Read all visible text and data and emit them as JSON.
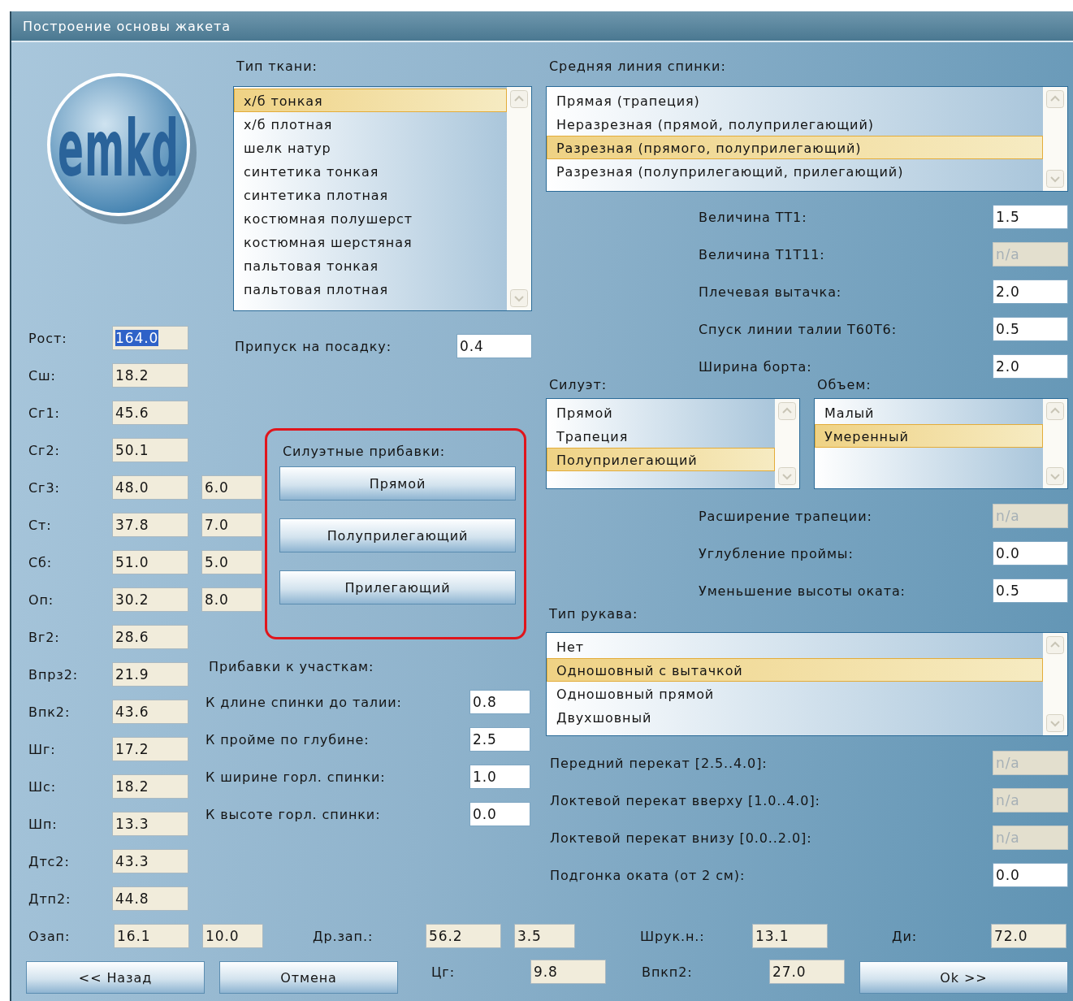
{
  "window": {
    "title": "Построение основы жакета"
  },
  "logo": {
    "text": "emkd"
  },
  "measurements": [
    {
      "label": "Рост:",
      "fields": [
        {
          "value": "164.0",
          "kind": "calc",
          "highlighted": true
        }
      ]
    },
    {
      "label": "Сш:",
      "fields": [
        {
          "value": "18.2",
          "kind": "calc"
        }
      ]
    },
    {
      "label": "Сг1:",
      "fields": [
        {
          "value": "45.6",
          "kind": "calc"
        }
      ]
    },
    {
      "label": "Сг2:",
      "fields": [
        {
          "value": "50.1",
          "kind": "calc"
        }
      ]
    },
    {
      "label": "Сг3:",
      "fields": [
        {
          "value": "48.0",
          "kind": "calc"
        },
        {
          "value": "6.0",
          "kind": "calc"
        }
      ]
    },
    {
      "label": "Ст:",
      "fields": [
        {
          "value": "37.8",
          "kind": "calc"
        },
        {
          "value": "7.0",
          "kind": "calc"
        }
      ]
    },
    {
      "label": "Сб:",
      "fields": [
        {
          "value": "51.0",
          "kind": "calc"
        },
        {
          "value": "5.0",
          "kind": "calc"
        }
      ]
    },
    {
      "label": "Оп:",
      "fields": [
        {
          "value": "30.2",
          "kind": "calc"
        },
        {
          "value": "8.0",
          "kind": "calc"
        }
      ]
    },
    {
      "label": "Вг2:",
      "fields": [
        {
          "value": "28.6",
          "kind": "calc"
        }
      ]
    },
    {
      "label": "Впрз2:",
      "fields": [
        {
          "value": "21.9",
          "kind": "calc"
        }
      ]
    },
    {
      "label": "Впк2:",
      "fields": [
        {
          "value": "43.6",
          "kind": "calc"
        }
      ]
    },
    {
      "label": "Шг:",
      "fields": [
        {
          "value": "17.2",
          "kind": "calc"
        }
      ]
    },
    {
      "label": "Шс:",
      "fields": [
        {
          "value": "18.2",
          "kind": "calc"
        }
      ]
    },
    {
      "label": "Шп:",
      "fields": [
        {
          "value": "13.3",
          "kind": "calc"
        }
      ]
    },
    {
      "label": "Дтс2:",
      "fields": [
        {
          "value": "43.3",
          "kind": "calc"
        }
      ]
    },
    {
      "label": "Дтп2:",
      "fields": [
        {
          "value": "44.8",
          "kind": "calc"
        }
      ]
    }
  ],
  "fabric": {
    "label": "Тип ткани:",
    "items": [
      {
        "label": "х/б тонкая",
        "selected": true
      },
      {
        "label": "х/б плотная",
        "selected": false
      },
      {
        "label": "шелк натур",
        "selected": false
      },
      {
        "label": "синтетика тонкая",
        "selected": false
      },
      {
        "label": "синтетика плотная",
        "selected": false
      },
      {
        "label": "костюмная полушерст",
        "selected": false
      },
      {
        "label": "костюмная шерстяная",
        "selected": false
      },
      {
        "label": "пальтовая тонкая",
        "selected": false
      },
      {
        "label": "пальтовая плотная",
        "selected": false
      }
    ]
  },
  "fit_allowance": {
    "label": "Припуск на посадку:",
    "fields": [
      {
        "value": "0.4",
        "kind": "input"
      }
    ]
  },
  "silhouette_allowances": {
    "label": "Силуэтные прибавки:",
    "annotated": true,
    "buttons": [
      "Прямой",
      "Полуприлегающий",
      "Прилегающий"
    ]
  },
  "section_allowances": {
    "label": "Прибавки к участкам:",
    "rows": [
      {
        "label": "К длине спинки до талии:",
        "fields": [
          {
            "value": "0.8",
            "kind": "input"
          }
        ]
      },
      {
        "label": "К пройме по глубине:",
        "fields": [
          {
            "value": "2.5",
            "kind": "input"
          }
        ]
      },
      {
        "label": "К ширине горл. спинки:",
        "fields": [
          {
            "value": "1.0",
            "kind": "input"
          }
        ]
      },
      {
        "label": "К высоте горл. спинки:",
        "fields": [
          {
            "value": "0.0",
            "kind": "input"
          }
        ]
      }
    ]
  },
  "back_center_line": {
    "label": "Средняя линия спинки:",
    "items": [
      {
        "label": "Прямая (трапеция)",
        "selected": false
      },
      {
        "label": "Неразрезная (прямой, полуприлегающий)",
        "selected": false
      },
      {
        "label": "Разрезная (прямого, полуприлегающий)",
        "selected": true
      },
      {
        "label": "Разрезная (полуприлегающий, прилегающий)",
        "selected": false
      }
    ]
  },
  "back_params": [
    {
      "label": "Величина ТТ1:",
      "fields": [
        {
          "value": "1.5",
          "kind": "input"
        }
      ]
    },
    {
      "label": "Величина Т1Т11:",
      "fields": [
        {
          "value": "n/a",
          "kind": "disabled"
        }
      ]
    },
    {
      "label": "Плечевая вытачка:",
      "fields": [
        {
          "value": "2.0",
          "kind": "input"
        }
      ]
    },
    {
      "label": "Спуск линии талии Т60Т6:",
      "fields": [
        {
          "value": "0.5",
          "kind": "input"
        }
      ]
    },
    {
      "label": "Ширина борта:",
      "fields": [
        {
          "value": "2.0",
          "kind": "input"
        }
      ]
    }
  ],
  "silhouette": {
    "label": "Силуэт:",
    "items": [
      {
        "label": "Прямой",
        "selected": false
      },
      {
        "label": "Трапеция",
        "selected": false
      },
      {
        "label": "Полуприлегающий",
        "selected": true
      }
    ]
  },
  "volume": {
    "label": "Объем:",
    "items": [
      {
        "label": "Малый",
        "selected": false
      },
      {
        "label": "Умеренный",
        "selected": true
      }
    ]
  },
  "shape_params": [
    {
      "label": "Расширение трапеции:",
      "fields": [
        {
          "value": "n/a",
          "kind": "disabled"
        }
      ]
    },
    {
      "label": "Углубление проймы:",
      "fields": [
        {
          "value": "0.0",
          "kind": "input"
        }
      ]
    },
    {
      "label": "Уменьшение высоты оката:",
      "fields": [
        {
          "value": "0.5",
          "kind": "input"
        }
      ]
    }
  ],
  "sleeve_type": {
    "label": "Тип рукава:",
    "items": [
      {
        "label": "Нет",
        "selected": false
      },
      {
        "label": "Одношовный с вытачкой",
        "selected": true
      },
      {
        "label": "Одношовный прямой",
        "selected": false
      },
      {
        "label": "Двухшовный",
        "selected": false
      }
    ]
  },
  "sleeve_params": [
    {
      "label": "Передний перекат [2.5..4.0]:",
      "fields": [
        {
          "value": "n/a",
          "kind": "disabled"
        }
      ]
    },
    {
      "label": "Локтевой перекат вверху [1.0..4.0]:",
      "fields": [
        {
          "value": "n/a",
          "kind": "disabled"
        }
      ]
    },
    {
      "label": "Локтевой перекат внизу [0.0..2.0]:",
      "fields": [
        {
          "value": "n/a",
          "kind": "disabled"
        }
      ]
    },
    {
      "label": "Подгонка оката (от 2 см):",
      "fields": [
        {
          "value": "0.0",
          "kind": "input"
        }
      ]
    }
  ],
  "bottom_row": [
    {
      "kind": "field",
      "label": "Озап:",
      "fields": [
        {
          "value": "16.1",
          "kind": "calc"
        },
        {
          "value": "10.0",
          "kind": "calc"
        }
      ]
    },
    {
      "kind": "field",
      "label": "Др.зап.:",
      "fields": [
        {
          "value": "56.2",
          "kind": "calc"
        },
        {
          "value": "3.5",
          "kind": "calc"
        }
      ]
    },
    {
      "kind": "field",
      "label": "Шрук.н.:",
      "fields": [
        {
          "value": "13.1",
          "kind": "calc"
        }
      ]
    },
    {
      "kind": "field",
      "label": "Ди:",
      "fields": [
        {
          "value": "72.0",
          "kind": "calc"
        }
      ]
    }
  ],
  "action_row": [
    {
      "kind": "button",
      "label": "<< Назад"
    },
    {
      "kind": "button",
      "label": "Отмена"
    },
    {
      "kind": "field",
      "label": "Цг:",
      "fields": [
        {
          "value": "9.8",
          "kind": "calc"
        }
      ]
    },
    {
      "kind": "field",
      "label": "Впкп2:",
      "fields": [
        {
          "value": "27.0",
          "kind": "calc"
        }
      ]
    },
    {
      "kind": "button",
      "label": "Ok >>"
    }
  ]
}
